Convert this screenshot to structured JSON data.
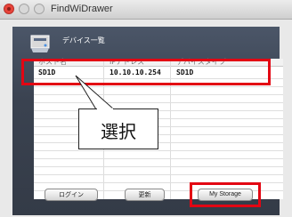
{
  "window": {
    "title": "FindWiDrawer"
  },
  "panel": {
    "title": "デバイス一覧"
  },
  "table": {
    "headers": [
      "ホスト名",
      "IPアドレス",
      "デバイスタイプ"
    ],
    "rows": [
      [
        "SD1D",
        "10.10.10.254",
        "SD1D"
      ]
    ]
  },
  "callout": {
    "text": "選択"
  },
  "buttons": {
    "login": "ログイン",
    "refresh": "更新",
    "storage": "My Storage"
  },
  "colors": {
    "highlight": "#e30613",
    "panel": "#3a4250"
  }
}
